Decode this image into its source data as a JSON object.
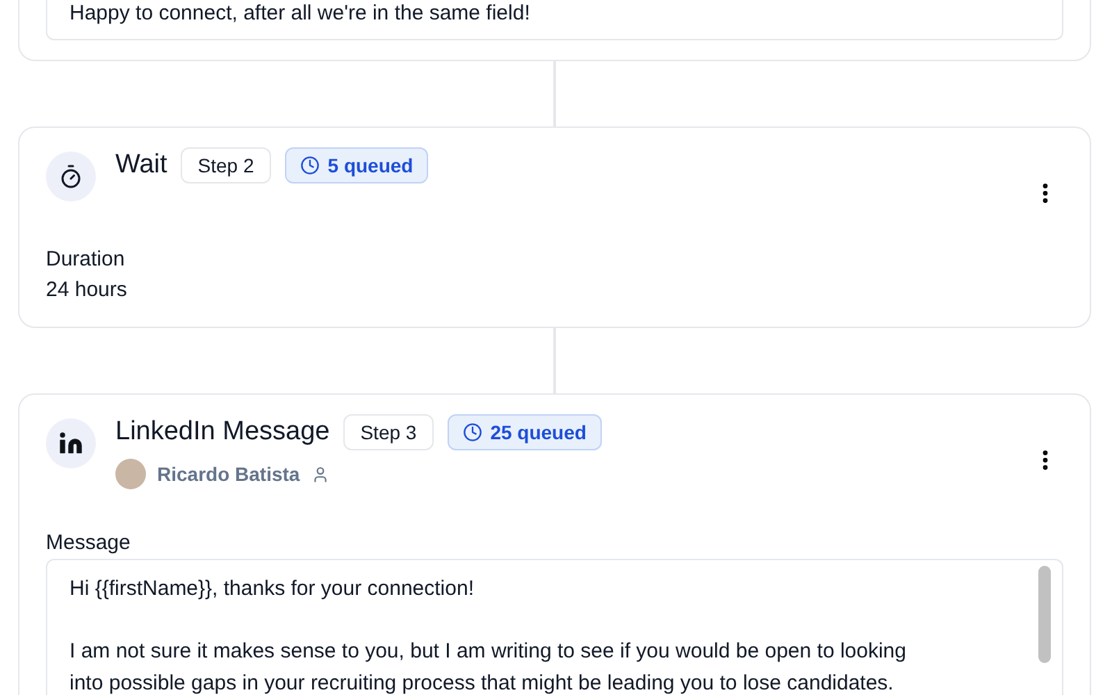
{
  "previous_step": {
    "message": "Happy to connect, after all we're in the same field!"
  },
  "steps": [
    {
      "kind": "wait",
      "title": "Wait",
      "step": "Step 2",
      "queued": "5 queued",
      "field_label": "Duration",
      "field_value": "24 hours"
    },
    {
      "kind": "linkedin",
      "title": "LinkedIn Message",
      "step": "Step 3",
      "queued": "25 queued",
      "author": "Ricardo Batista",
      "field_label": "Message",
      "message_paragraphs": [
        [
          "Hi {{firstName}}, thanks for your connection!"
        ],
        [
          "I am not sure it makes sense to you, but I am writing to see if you would be open to looking",
          "into possible gaps in your recruiting process that might be leading you to lose candidates."
        ]
      ]
    }
  ]
}
